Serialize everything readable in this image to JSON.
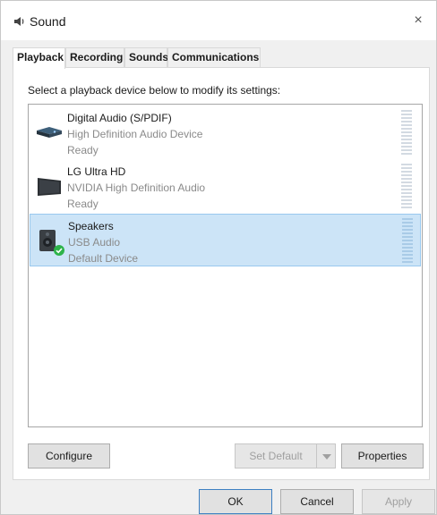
{
  "window": {
    "title": "Sound",
    "close_label": "×"
  },
  "tabs": [
    {
      "label": "Playback",
      "active": true
    },
    {
      "label": "Recording",
      "active": false
    },
    {
      "label": "Sounds",
      "active": false
    },
    {
      "label": "Communications",
      "active": false
    }
  ],
  "instruction": "Select a playback device below to modify its settings:",
  "devices": [
    {
      "name": "Digital Audio (S/PDIF)",
      "description": "High Definition Audio Device",
      "status": "Ready",
      "icon": "spdif-device-icon",
      "selected": false
    },
    {
      "name": "LG Ultra HD",
      "description": "NVIDIA High Definition Audio",
      "status": "Ready",
      "icon": "monitor-icon",
      "selected": false
    },
    {
      "name": "Speakers",
      "description": "USB Audio",
      "status": "Default Device",
      "icon": "speaker-icon",
      "selected": true
    }
  ],
  "buttons": {
    "configure": "Configure",
    "set_default": "Set Default",
    "properties": "Properties",
    "ok": "OK",
    "cancel": "Cancel",
    "apply": "Apply"
  },
  "colors": {
    "selection": "#cce4f7",
    "selection_border": "#99c9ef",
    "default_check": "#2db34a"
  }
}
